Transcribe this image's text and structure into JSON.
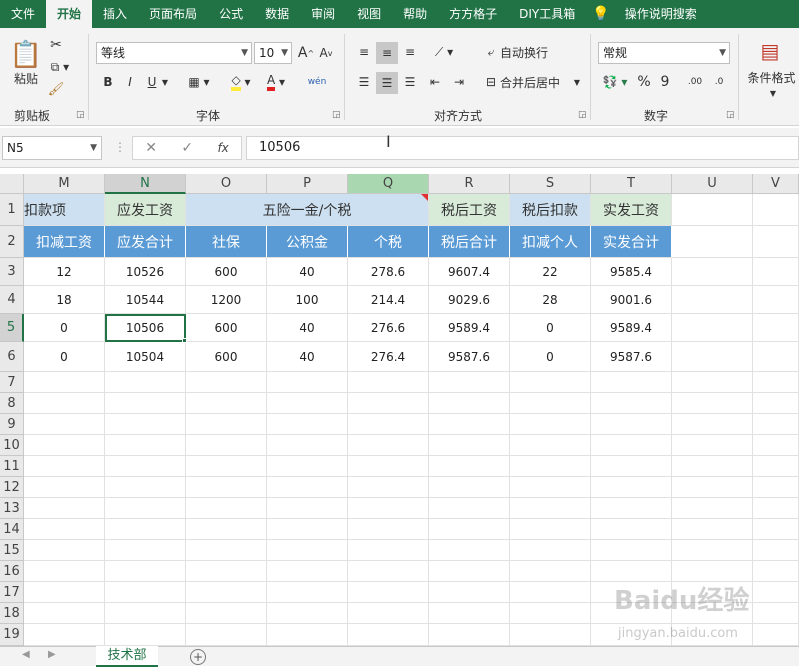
{
  "tabs": [
    "文件",
    "开始",
    "插入",
    "页面布局",
    "公式",
    "数据",
    "审阅",
    "视图",
    "帮助",
    "方方格子",
    "DIY工具箱",
    "操作说明搜索"
  ],
  "active_tab": "开始",
  "ribbon": {
    "clipboard": {
      "paste_label": "粘贴",
      "group_label": "剪贴板"
    },
    "font": {
      "font_name": "等线",
      "font_size": "10",
      "group_label": "字体",
      "bold": "B",
      "italic": "I",
      "underline": "U",
      "font_color_glyph": "A",
      "wen": "wén"
    },
    "alignment": {
      "wrap_text": "自动换行",
      "merge_center": "合并后居中",
      "group_label": "对齐方式"
    },
    "number": {
      "format": "常规",
      "group_label": "数字",
      "percent": "%",
      "comma": "9"
    },
    "styles": {
      "conditional_format": "条件格式"
    }
  },
  "formula_bar": {
    "name_box": "N5",
    "formula": "10506",
    "fx": "fx"
  },
  "columns": [
    "M",
    "N",
    "O",
    "P",
    "Q",
    "R",
    "S",
    "T",
    "U",
    "V"
  ],
  "rows": [
    "1",
    "2",
    "3",
    "4",
    "5",
    "6",
    "7",
    "8",
    "9",
    "10",
    "11",
    "12",
    "13",
    "14",
    "15",
    "16",
    "17",
    "18",
    "19"
  ],
  "header_row1": {
    "m": "扣款项",
    "n": "应发工资",
    "opq": "五险一金/个税",
    "r": "税后工资",
    "s": "税后扣款",
    "t": "实发工资"
  },
  "header_row2": [
    "扣减工资",
    "应发合计",
    "社保",
    "公积金",
    "个税",
    "税后合计",
    "扣减个人",
    "实发合计"
  ],
  "data_rows": [
    [
      "12",
      "10526",
      "600",
      "40",
      "278.6",
      "9607.4",
      "22",
      "9585.4"
    ],
    [
      "18",
      "10544",
      "1200",
      "100",
      "214.4",
      "9029.6",
      "28",
      "9001.6"
    ],
    [
      "0",
      "10506",
      "600",
      "40",
      "276.6",
      "9589.4",
      "0",
      "9589.4"
    ],
    [
      "0",
      "10504",
      "600",
      "40",
      "276.4",
      "9587.6",
      "0",
      "9587.6"
    ]
  ],
  "sheet_tab": "技术部",
  "watermark": "Baidu经验",
  "watermark_url": "jingyan.baidu.com"
}
